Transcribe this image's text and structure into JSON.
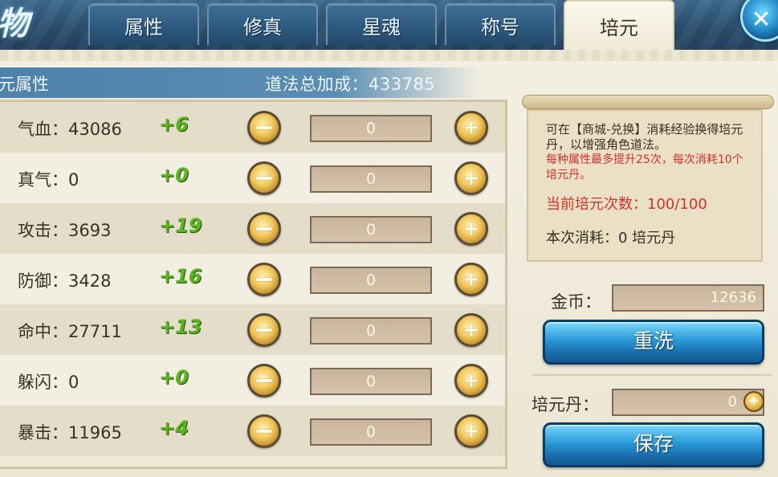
{
  "header": {
    "title_fragment": "物",
    "tabs": [
      {
        "label": "属性",
        "active": false
      },
      {
        "label": "修真",
        "active": false
      },
      {
        "label": "星魂",
        "active": false
      },
      {
        "label": "称号",
        "active": false
      },
      {
        "label": "培元",
        "active": true
      }
    ],
    "close_icon": "x"
  },
  "left": {
    "section_label": "元属性",
    "total_label": "道法总加成：433785",
    "rows": [
      {
        "name": "气血：43086",
        "bonus": "+6",
        "value": "0"
      },
      {
        "name": "真气：0",
        "bonus": "+0",
        "value": "0"
      },
      {
        "name": "攻击：3693",
        "bonus": "+19",
        "value": "0"
      },
      {
        "name": "防御：3428",
        "bonus": "+16",
        "value": "0"
      },
      {
        "name": "命中：27711",
        "bonus": "+13",
        "value": "0"
      },
      {
        "name": "躲闪：0",
        "bonus": "+0",
        "value": "0"
      },
      {
        "name": "暴击：11965",
        "bonus": "+4",
        "value": "0"
      }
    ],
    "minus_icon": "minus-icon",
    "plus_icon": "plus-icon"
  },
  "right": {
    "info_desc": "可在【商城-兑换】消耗经验换得培元丹，以增强角色道法。",
    "info_warning": "每种属性最多提升25次，每次消耗10个培元丹。",
    "current_count": "当前培元次数：100/100",
    "cost": "本次消耗：0 培元丹",
    "gold_label": "金币：",
    "gold_value": "12636",
    "reset_button": "重洗",
    "pill_label": "培元丹：",
    "pill_value": "0",
    "save_button": "保存"
  },
  "colors": {
    "bonus_green": "#5ab51f",
    "warning_red": "#d8302c",
    "button_blue": "#2a9ad6"
  }
}
